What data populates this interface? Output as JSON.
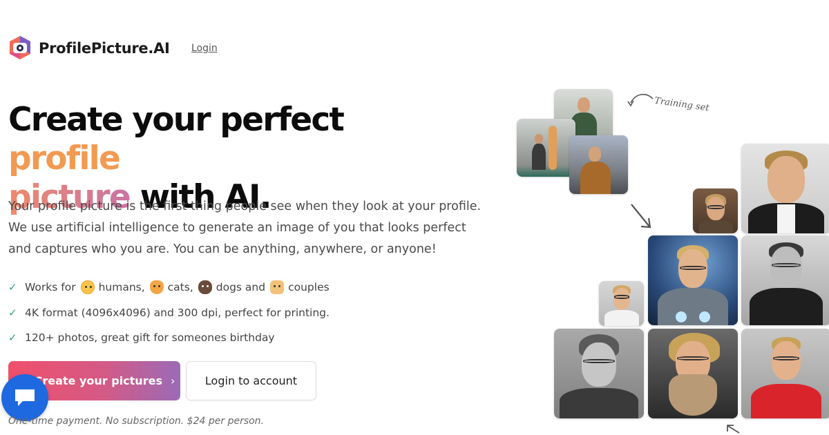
{
  "header": {
    "brand": "ProfilePicture.AI",
    "login_link": "Login"
  },
  "hero": {
    "headline_part1": "Create your perfect ",
    "headline_accent1": "profile",
    "headline_accent2": "picture",
    "headline_part2": " with AI.",
    "lead": "Your profile picture is the first thing people see when they look at your profile. We use artificial intelligence to generate an image of you that looks perfect and captures who you are. You can be anything, anywhere, or anyone!"
  },
  "features": [
    {
      "prefix": "Works for",
      "parts": [
        {
          "emoji": "human-emoji",
          "text": "humans,"
        },
        {
          "emoji": "cat-emoji",
          "text": "cats,"
        },
        {
          "emoji": "dog-emoji",
          "text": "dogs and"
        },
        {
          "emoji": "couple-emoji",
          "text": "couples"
        }
      ]
    },
    {
      "text": "4K format (4096x4096) and 300 dpi, perfect for printing."
    },
    {
      "text": "120+ photos, great gift for someones birthday"
    }
  ],
  "cta": {
    "primary": "Create your pictures",
    "primary_icon": "chevron-right-icon",
    "secondary": "Login to account",
    "note": "One-time payment. No subscription. $24 per person."
  },
  "collage": {
    "training_label": "Training set"
  },
  "colors": {
    "accent_orange": "#f39a52",
    "accent_pink": "#d45a86",
    "accent_purple": "#9a6bb6",
    "check_green": "#34a07a",
    "chat_blue": "#1e68e0"
  }
}
